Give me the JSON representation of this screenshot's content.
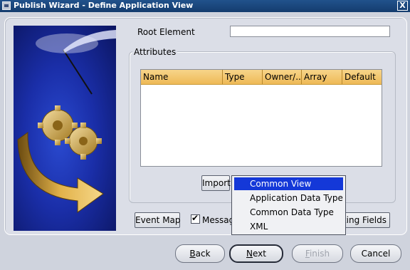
{
  "window": {
    "title": "Publish Wizard - Define Application View",
    "close_glyph": "X"
  },
  "form": {
    "root_element_label": "Root Element",
    "root_element_value": "",
    "attributes_label": "Attributes"
  },
  "attributes_table": {
    "columns": [
      "Name",
      "Type",
      "Owner/...",
      "Array",
      "Default"
    ],
    "rows": []
  },
  "buttons": {
    "import": "Import",
    "event_map": "Event Map",
    "message_checkbox_label": "Messag",
    "message_checked": true,
    "marking_fields": "king Fields"
  },
  "import_menu": {
    "items": [
      "Common View",
      "Application Data Type",
      "Common Data Type",
      "XML"
    ],
    "highlighted": "Common View"
  },
  "nav": {
    "back": "Back",
    "next": "Next",
    "finish": "Finish",
    "cancel": "Cancel",
    "back_mnemonic": "B",
    "next_mnemonic": "N",
    "finish_mnemonic": "F"
  },
  "icons": {
    "wizard_graphic": "gears-arrow-graphic",
    "title_icon": "app-window-icon",
    "close": "close-icon"
  }
}
